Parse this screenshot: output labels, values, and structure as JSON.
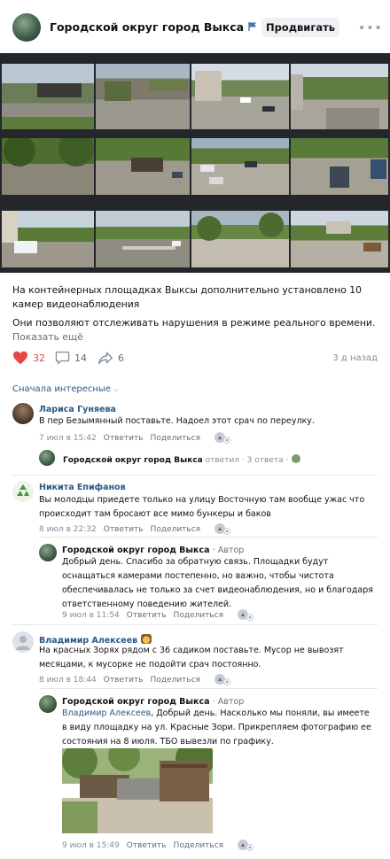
{
  "post": {
    "community_name": "Городской округ город Выкса",
    "promote_label": "Продвигать",
    "text_1": "На контейнерных площадках Выксы дополнительно установлено 10 камер видеонаблюдения",
    "text_2": "Они позволяют отслеживать нарушения в режиме реального времени.",
    "show_more": "Показать ещё",
    "likes": "32",
    "comments": "14",
    "shares": "6",
    "time_ago": "3 д назад",
    "sort_label": "Сначала интересные"
  },
  "comments": [
    {
      "author": "Лариса Гуняева",
      "text": "В пер Безымянный поставьте. Надоел этот срач по переулку.",
      "date": "7 июл в 15:42",
      "reply": "Ответить",
      "share": "Поделиться"
    },
    {
      "thread_author": "Городской округ город Выкса",
      "thread_action": "ответил",
      "thread_count": "3 ответа"
    },
    {
      "author": "Никита Епифанов",
      "text": "Вы молодцы приедете только на улицу Восточную там вообще ужас что происходит там бросают все мимо бункеры и баков",
      "date": "8 июл в 22:32",
      "reply": "Ответить",
      "share": "Поделиться"
    },
    {
      "author": "Городской округ город Выкса",
      "badge": "· Автор",
      "text": "Добрый день. Спасибо за обратную связь. Площадки будут оснащаться камерами постепенно, но важно, чтобы чистота обеспечивалась не только за счет видеонаблюдения, но и благодаря ответственному поведению жителей.",
      "date": "9 июл в 11:54",
      "reply": "Ответить",
      "share": "Поделиться"
    },
    {
      "author": "Владимир Алексеев",
      "text": "На красных Зорях рядом с 36 садиком поставьте. Мусор не вывозят месяцами, к мусорке не подойти срач постоянно.",
      "date": "8 июл в 18:44",
      "reply": "Ответить",
      "share": "Поделиться"
    },
    {
      "author": "Городской округ город Выкса",
      "badge": "· Автор",
      "mention": "Владимир Алексеев",
      "text": ", Добрый день. Насколько мы поняли, вы имеете в виду площадку на ул. Красные Зори. Прикрепляем фотографию ее состояния на 8 июля. ТБО вывезли по графику.",
      "date": "9 июл в 15:49",
      "reply": "Ответить",
      "share": "Поделиться"
    }
  ],
  "colors": {
    "link": "#2a5885",
    "like": "#e64646",
    "muted": "#626d7a",
    "verified": "#4a76a8"
  }
}
